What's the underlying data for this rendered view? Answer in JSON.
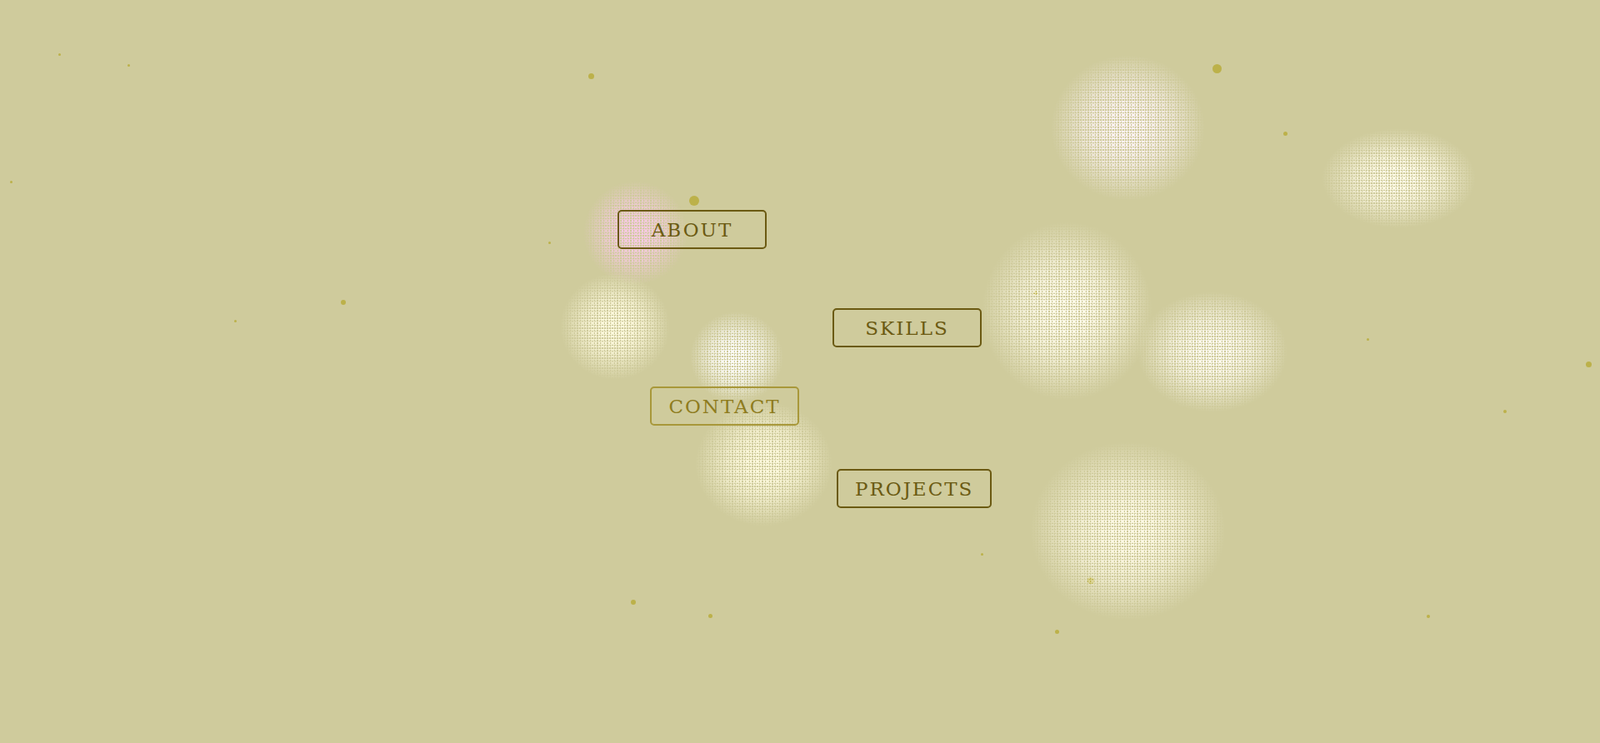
{
  "nav": [
    {
      "label": "ABOUT",
      "selected": false
    },
    {
      "label": "SKILLS",
      "selected": false
    },
    {
      "label": "CONTACT",
      "selected": true
    },
    {
      "label": "PROJECTS",
      "selected": false
    }
  ],
  "particles": [
    {
      "color": "#f6c9e4"
    },
    {
      "color": "#fffbe0"
    },
    {
      "color": "#ffffff"
    },
    {
      "color": "#fffbe0"
    },
    {
      "color": "#fdf3f6"
    },
    {
      "color": "#fffbe8"
    },
    {
      "color": "#fffcec"
    },
    {
      "color": "#fffcf2"
    },
    {
      "color": "#fffbe8"
    }
  ]
}
